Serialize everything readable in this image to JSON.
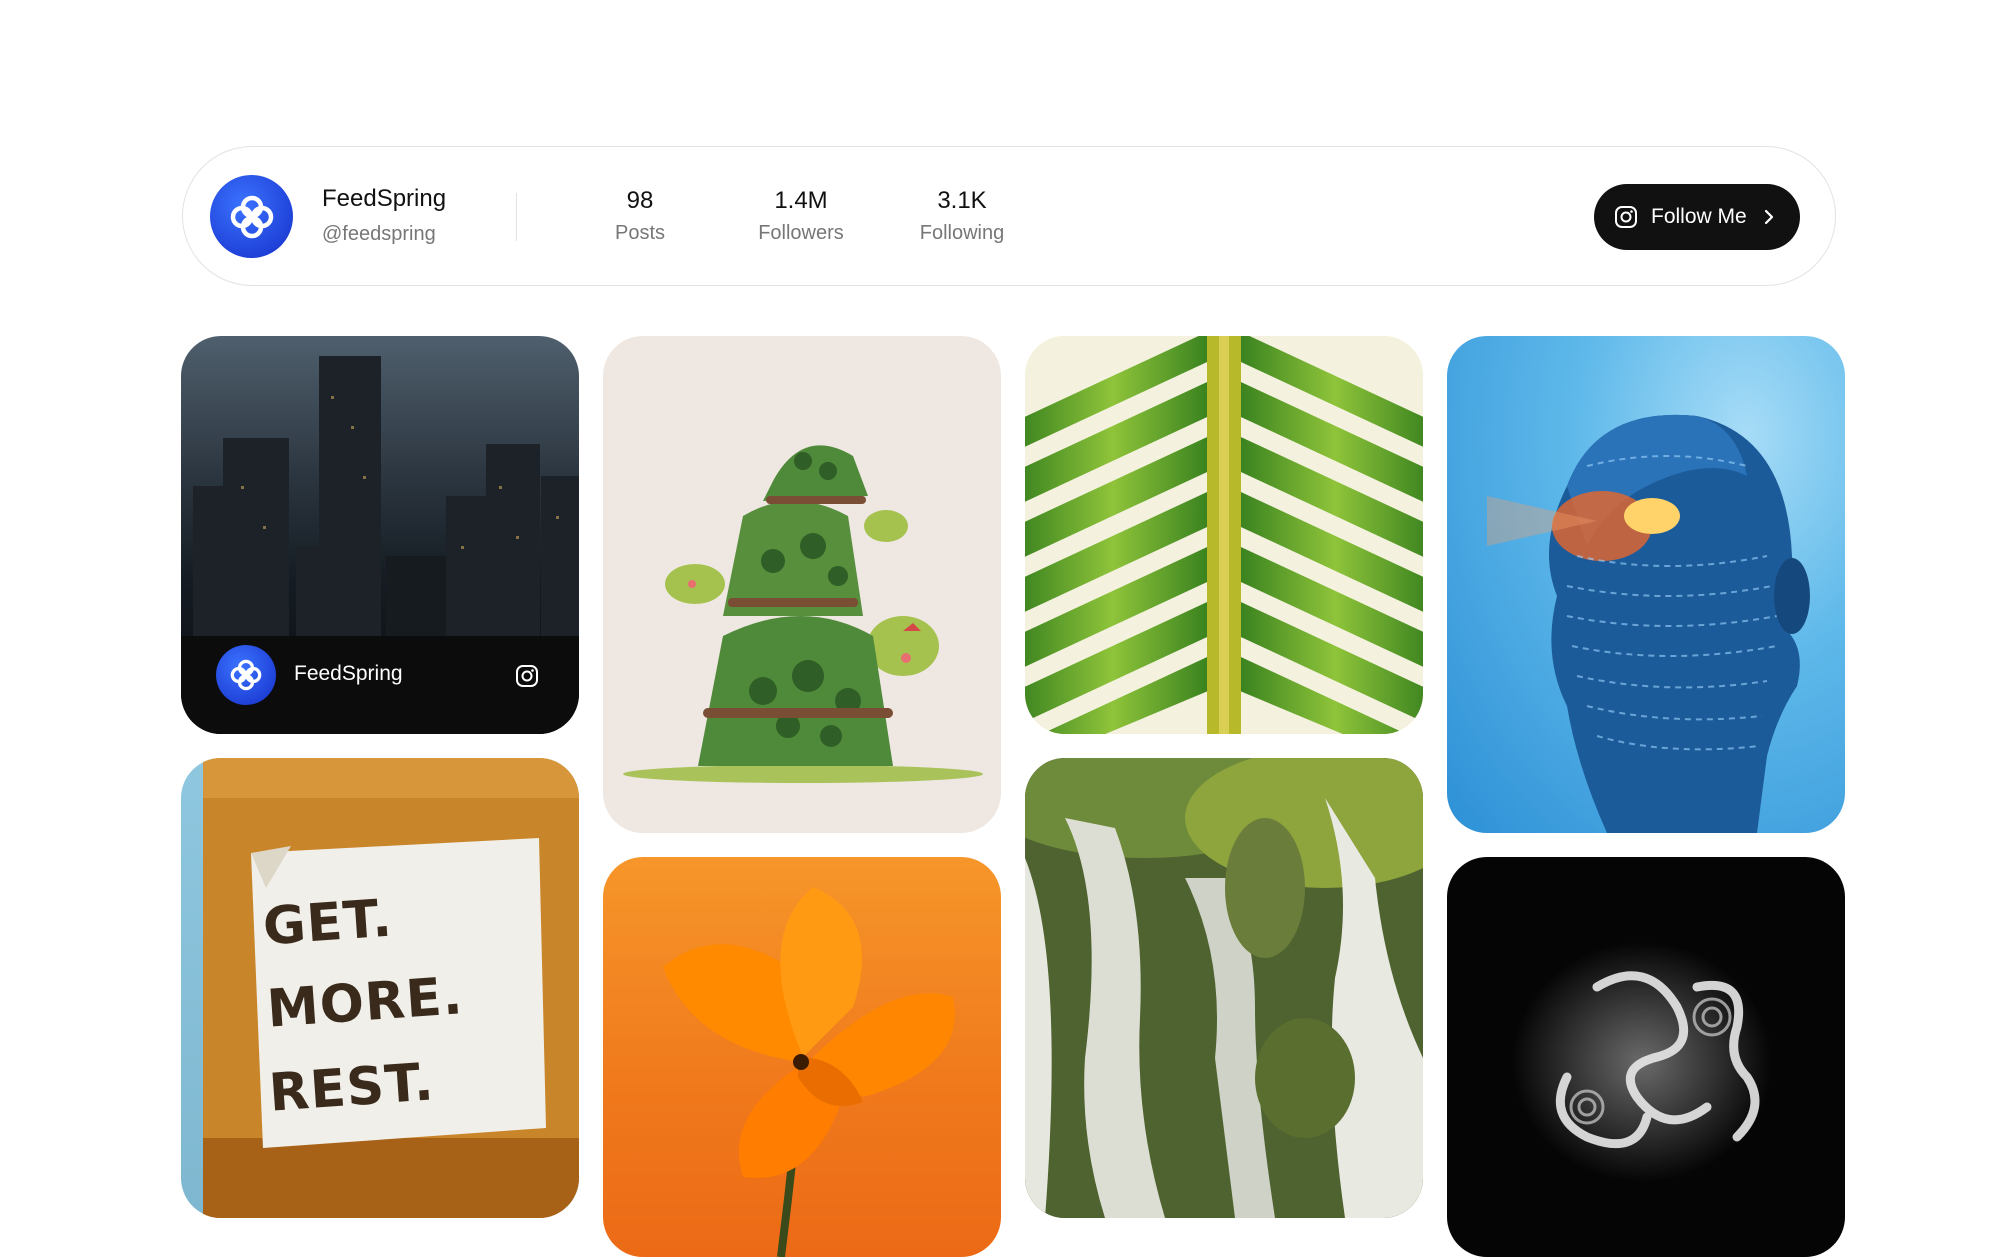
{
  "profile": {
    "name": "FeedSpring",
    "handle": "@feedspring",
    "stats": [
      {
        "value": "98",
        "label": "Posts"
      },
      {
        "value": "1.4M",
        "label": "Followers"
      },
      {
        "value": "3.1K",
        "label": "Following"
      }
    ],
    "follow_label": "Follow Me"
  },
  "feed": {
    "overlay_name": "FeedSpring",
    "sign_lines": [
      "GET.",
      "MORE.",
      "REST."
    ]
  },
  "colors": {
    "brand": "#2148e8",
    "button": "#111111"
  },
  "icons": {
    "logo": "clover-logo-icon",
    "instagram": "instagram-icon",
    "chevron": "chevron-right-icon"
  }
}
